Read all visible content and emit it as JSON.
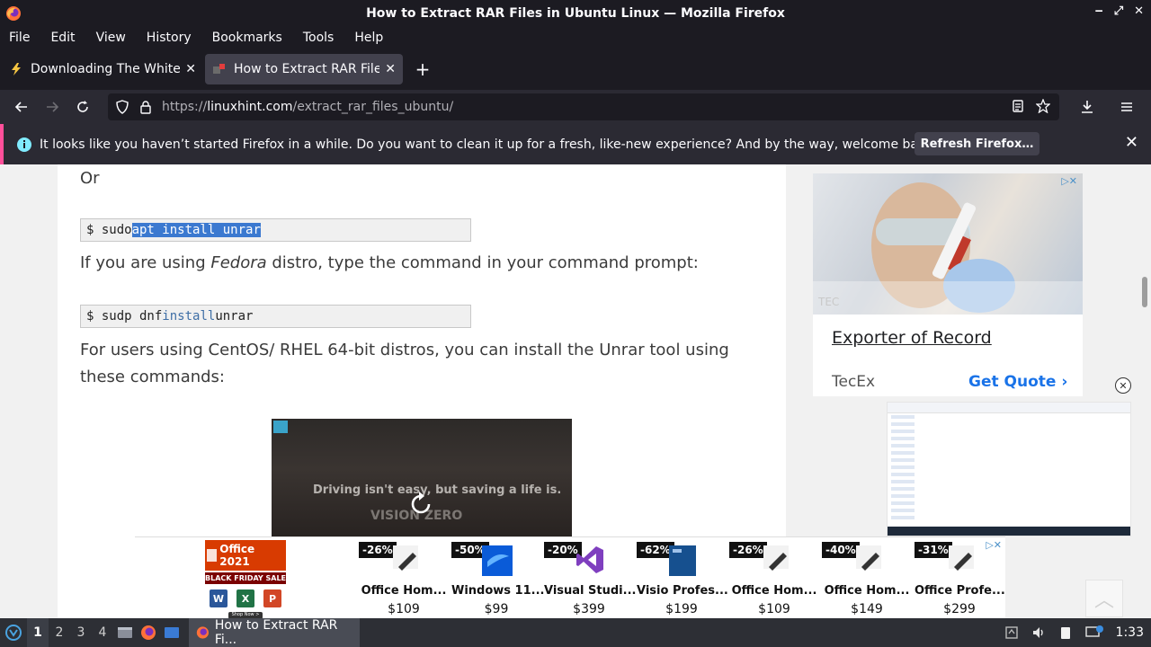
{
  "window": {
    "title": "How to Extract RAR Files in Ubuntu Linux — Mozilla Firefox",
    "controls": [
      "‒",
      "⤢",
      "✕"
    ]
  },
  "menu": [
    "File",
    "Edit",
    "View",
    "History",
    "Bookmarks",
    "Tools",
    "Help"
  ],
  "tabs": [
    {
      "title": "Downloading The White I",
      "icon": "lightning-icon",
      "active": false
    },
    {
      "title": "How to Extract RAR Files",
      "icon": "linuxhint-favicon",
      "active": true
    }
  ],
  "newtab_label": "+",
  "url": {
    "prefix": "https://",
    "domain": "linuxhint.com",
    "path": "/extract_rar_files_ubuntu/"
  },
  "notification": {
    "message": "It looks like you haven’t started Firefox in a while. Do you want to clean it up for a fresh, like-new experience? And by the way, welcome back!",
    "button": "Refresh Firefox…"
  },
  "article": {
    "or": "Or",
    "code1": {
      "prompt": "$ sudo ",
      "selected": "apt install unrar"
    },
    "fedora_pre": "If you are using ",
    "fedora_em": "Fedora",
    "fedora_post": " distro, type the command in your command prompt:",
    "code2": {
      "prompt": "$ sudp dnf ",
      "kw": "install",
      "rest": " unrar"
    },
    "centos": "For users using CentOS/ RHEL 64-bit distros, you can install the Unrar tool using these commands:",
    "video_text": "Driving isn't easy, but saving a life is.",
    "video_text2": "VISION ZERO"
  },
  "side_ad": {
    "title": "Exporter of Record",
    "advertiser": "TecEx",
    "cta": "Get Quote ›",
    "watermark": "TEC"
  },
  "bottom_ad": {
    "brand": "Office 2021",
    "sale": "BLACK FRIDAY SALE",
    "shop": "Shop Now >",
    "products": [
      {
        "discount": "-26%",
        "name": "Office Hom...",
        "price": "$109"
      },
      {
        "discount": "-50%",
        "name": "Windows 11...",
        "price": "$99"
      },
      {
        "discount": "-20%",
        "name": "Visual Studi...",
        "price": "$399"
      },
      {
        "discount": "-62%",
        "name": "Visio Profes...",
        "price": "$199"
      },
      {
        "discount": "-26%",
        "name": "Office Hom...",
        "price": "$109"
      },
      {
        "discount": "-40%",
        "name": "Office Hom...",
        "price": "$149"
      },
      {
        "discount": "-31%",
        "name": "Office Profe...",
        "price": "$299"
      }
    ]
  },
  "taskbar": {
    "workspaces": [
      "1",
      "2",
      "3",
      "4"
    ],
    "active_workspace": "1",
    "window_label": "How to Extract RAR Fi...",
    "clock": "1:33"
  },
  "colors": {
    "chrome_dark": "#1c1b22",
    "toolbar": "#2b2a33",
    "notice_accent": "#ff4f9a",
    "selection": "#3b79d0",
    "link_blue": "#1a73e8"
  }
}
